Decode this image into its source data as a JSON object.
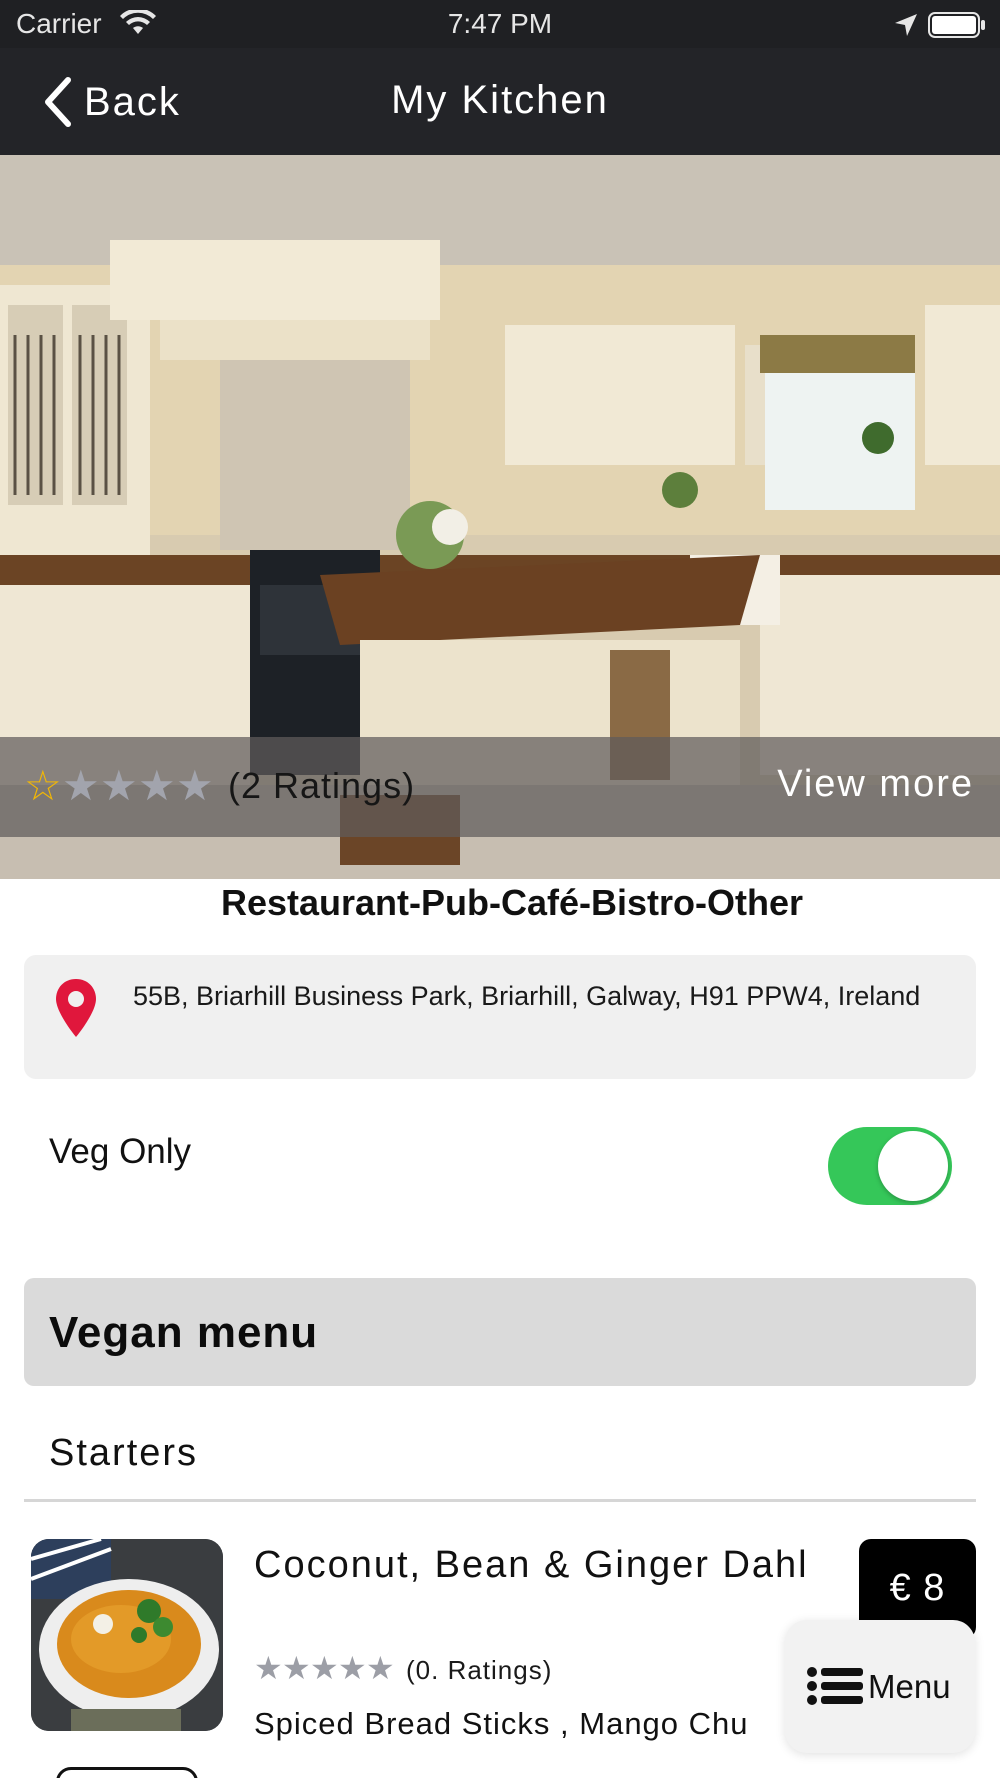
{
  "status_bar": {
    "carrier": "Carrier",
    "time": "7:47 PM",
    "icons": [
      "wifi-icon",
      "location-icon",
      "battery-icon"
    ]
  },
  "nav": {
    "back_label": "Back",
    "title": "My Kitchen"
  },
  "hero": {
    "rating": {
      "filled_stars": 1,
      "max_stars": 5,
      "count_label": "(2 Ratings)"
    },
    "view_more_label": "View more"
  },
  "category": "Restaurant-Pub-Café-Bistro-Other",
  "address": {
    "icon": "location-pin-icon",
    "text": "55B, Briarhill Business Park, Briarhill, Galway, H91 PPW4, Ireland"
  },
  "veg_filter": {
    "label": "Veg Only",
    "enabled": true
  },
  "menu": {
    "section_title": "Vegan menu",
    "subsection_title": "Starters",
    "items": [
      {
        "name": "Coconut, Bean & Ginger Dahl",
        "rating_stars": 0,
        "ratings_label": "(0. Ratings)",
        "description": "Spiced Bread Sticks , Mango Chu",
        "price": "€ 8"
      }
    ]
  },
  "floating_menu": {
    "label": "Menu",
    "icon": "list-icon"
  },
  "colors": {
    "bar_background": "#232428",
    "toggle_on": "#35c759",
    "pin_red": "#e0173c",
    "star_filled": "#f2b705",
    "star_empty": "#a2a4ad"
  }
}
